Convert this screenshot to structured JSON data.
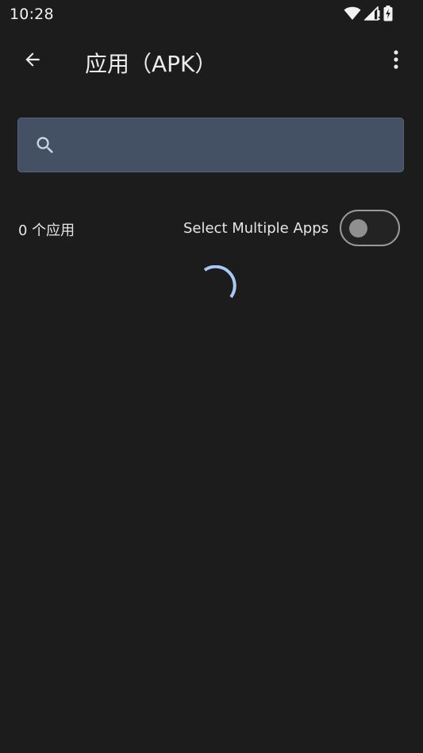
{
  "status_bar": {
    "time": "10:28",
    "icons": [
      "wifi-icon",
      "cell-signal-icon",
      "battery-charging-icon"
    ]
  },
  "app_bar": {
    "title": "应用（APK）",
    "back_icon": "arrow-back-icon",
    "menu_icon": "more-vert-icon"
  },
  "search": {
    "icon": "search-icon",
    "value": "",
    "placeholder": ""
  },
  "list_header": {
    "count_label": "0 个应用",
    "multi_select_label": "Select Multiple Apps",
    "multi_select_on": false
  },
  "loading": {
    "indicator": "loading-spinner",
    "visible": true
  },
  "colors": {
    "background": "#1c1c1d",
    "search_fill": "#445064",
    "spinner_accent": "#a8c8f8",
    "toggle_border": "#9a9a9a"
  }
}
